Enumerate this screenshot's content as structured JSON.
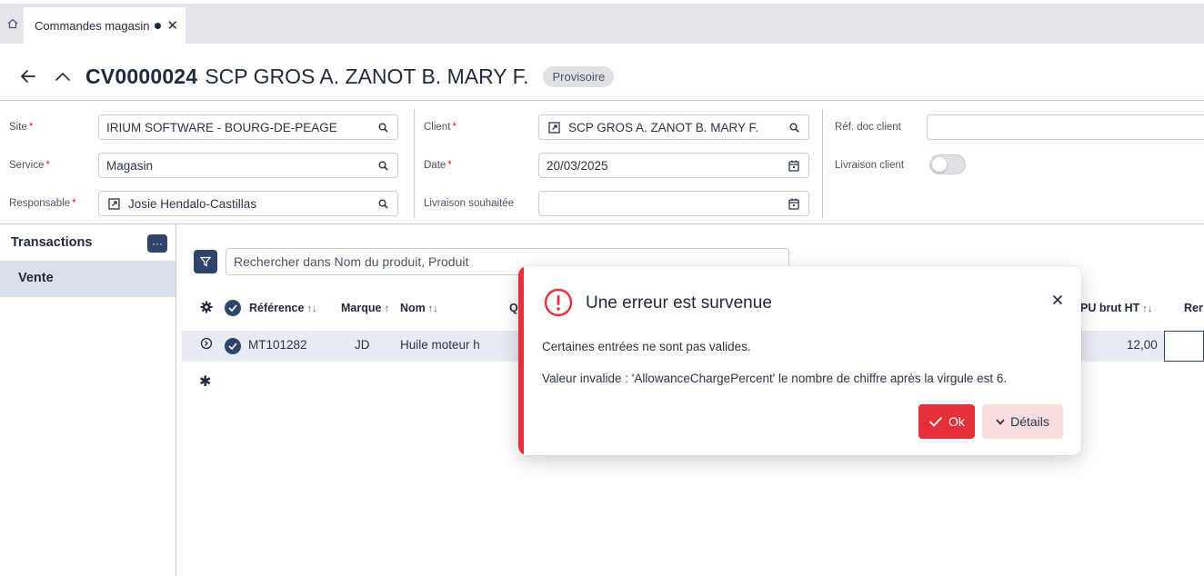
{
  "tabs": {
    "home_icon": "home-icon",
    "active": {
      "label": "Commandes magasin",
      "modified": true,
      "close": "✕"
    }
  },
  "header": {
    "doc_id": "CV0000024",
    "title": "SCP GROS A. ZANOT B. MARY F.",
    "status": "Provisoire"
  },
  "form": {
    "site": {
      "label": "Site",
      "value": "IRIUM SOFTWARE - BOURG-DE-PEAGE"
    },
    "service": {
      "label": "Service",
      "value": "Magasin"
    },
    "responsable": {
      "label": "Responsable",
      "value": "Josie Hendalo-Castillas"
    },
    "client": {
      "label": "Client",
      "value": "SCP GROS A. ZANOT B. MARY F."
    },
    "date": {
      "label": "Date",
      "value": "20/03/2025"
    },
    "livraison_souhaitee": {
      "label": "Livraison souhaitée",
      "value": ""
    },
    "ref_doc_client": {
      "label": "Réf. doc client",
      "value": ""
    },
    "livraison_client": {
      "label": "Livraison client",
      "enabled": false
    },
    "required_mark": "*"
  },
  "left_panel": {
    "title": "Transactions",
    "more": "···",
    "items": [
      {
        "label": "Vente"
      }
    ]
  },
  "grid": {
    "search_placeholder": "Rechercher dans Nom du produit, Produit",
    "sort_glyph": "↑↓",
    "sort_up_glyph": "↑",
    "columns": [
      "Référence",
      "Marque",
      "Nom",
      "Q",
      "PU brut HT",
      "Rer"
    ],
    "rows": [
      {
        "reference": "MT101282",
        "marque": "JD",
        "nom": "Huile moteur h",
        "pu_brut_ht": "12,00"
      }
    ],
    "new_row_marker": "✱"
  },
  "dialog": {
    "title": "Une erreur est survenue",
    "message1": "Certaines entrées ne sont pas valides.",
    "message2": "Valeur invalide : 'AllowanceChargePercent' le nombre de chiffre après la virgule est 6.",
    "ok_label": "Ok",
    "details_label": "Détails",
    "accent_color": "#e3303a"
  }
}
